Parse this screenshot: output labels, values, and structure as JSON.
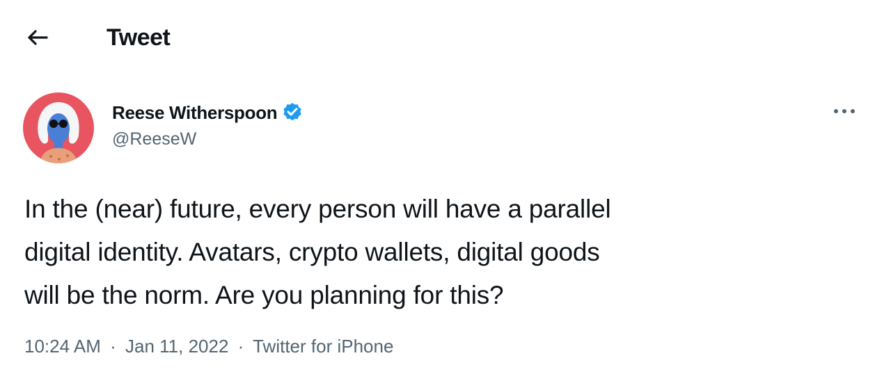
{
  "header": {
    "back_icon": "arrow-left-icon",
    "title": "Tweet"
  },
  "tweet": {
    "author": {
      "name": "Reese Witherspoon",
      "handle": "@ReeseW",
      "verified": true,
      "verified_icon": "verified-badge-icon",
      "avatar_icon": "avatar-illustration"
    },
    "more_icon": "more-horizontal-icon",
    "text_lines": [
      "In the (near) future, every person will have a parallel",
      "digital identity. Avatars, crypto wallets, digital goods",
      "will be the norm. Are you planning for this?"
    ],
    "meta": {
      "time": "10:24 AM",
      "separator": "·",
      "date": "Jan 11, 2022",
      "source": "Twitter for iPhone"
    }
  },
  "colors": {
    "text": "#0f1419",
    "secondary": "#536471",
    "verified": "#1d9bf0",
    "avatar_bg": "#e8545f"
  }
}
